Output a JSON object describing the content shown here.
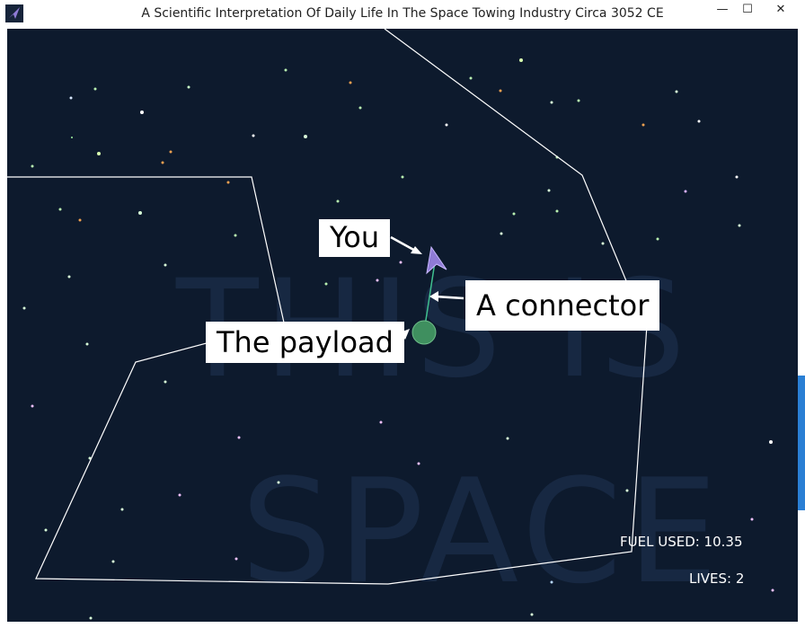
{
  "window": {
    "title": "A Scientific Interpretation Of Daily Life In The Space Towing Industry Circa 3052 CE",
    "min_glyph": "—",
    "max_glyph": "☐",
    "close_glyph": "✕"
  },
  "game": {
    "watermark_line1": "THIS IS",
    "watermark_line2": "SPACE",
    "labels": {
      "you": "You",
      "connector": "A connector",
      "payload": "The payload"
    },
    "hud": {
      "fuel": "FUEL USED: 10.35",
      "lives": "LIVES: 2"
    }
  },
  "colors": {
    "space_background": "#0d1a2d",
    "boundary_line": "#ffffff",
    "ship": "#8f7bd6",
    "connector": "#3fbf8f",
    "payload": "#3f8f5f",
    "scroll_accent": "#2a7fd4"
  }
}
